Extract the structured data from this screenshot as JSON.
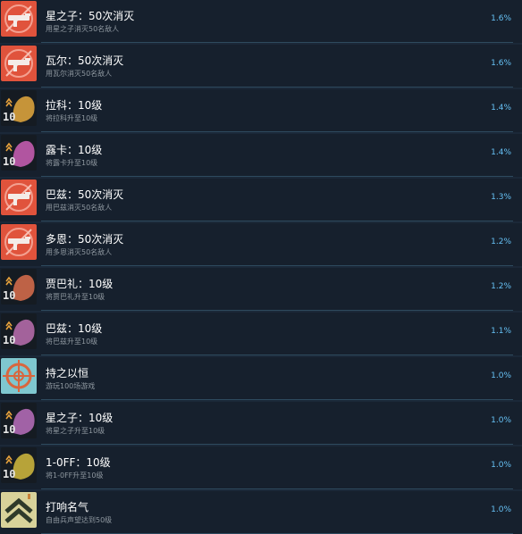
{
  "achievements": [
    {
      "title": "星之子：50次消灭",
      "desc": "用星之子消灭50名敌人",
      "percent": "1.6%",
      "icon": "weapon-kill-icon"
    },
    {
      "title": "瓦尔：50次消灭",
      "desc": "用瓦尔消灭50名敌人",
      "percent": "1.6%",
      "icon": "weapon-kill-icon"
    },
    {
      "title": "拉科：10级",
      "desc": "将拉科升至10级",
      "percent": "1.4%",
      "icon": "character-level-icon",
      "badge": "10"
    },
    {
      "title": "露卡：10级",
      "desc": "将露卡升至10级",
      "percent": "1.4%",
      "icon": "character-level-icon",
      "badge": "10"
    },
    {
      "title": "巴兹：50次消灭",
      "desc": "用巴兹消灭50名敌人",
      "percent": "1.3%",
      "icon": "weapon-kill-icon"
    },
    {
      "title": "多恩：50次消灭",
      "desc": "用多恩消灭50名敌人",
      "percent": "1.2%",
      "icon": "weapon-kill-icon"
    },
    {
      "title": "贾巴礼：10级",
      "desc": "将贾巴礼升至10级",
      "percent": "1.2%",
      "icon": "character-level-icon",
      "badge": "10"
    },
    {
      "title": "巴兹：10级",
      "desc": "将巴兹升至10级",
      "percent": "1.1%",
      "icon": "character-level-icon",
      "badge": "10"
    },
    {
      "title": "持之以恒",
      "desc": "游玩100场游戏",
      "percent": "1.0%",
      "icon": "crosshair-icon"
    },
    {
      "title": "星之子：10级",
      "desc": "将星之子升至10级",
      "percent": "1.0%",
      "icon": "character-level-icon",
      "badge": "10"
    },
    {
      "title": "1-0FF：10级",
      "desc": "将1-0FF升至10级",
      "percent": "1.0%",
      "icon": "character-level-icon",
      "badge": "10"
    },
    {
      "title": "打响名气",
      "desc": "自由兵声望达到50级",
      "percent": "1.0%",
      "icon": "rank-chevron-icon"
    }
  ],
  "colors": {
    "background": "#1b2838",
    "row": "#16202d",
    "divider": "#2e4a5e",
    "title": "#ffffff",
    "description": "#8f98a0",
    "percent": "#66c0f4",
    "kill_icon_bg": "#e0533c",
    "level_icon_bg": "#151b22",
    "crosshair_icon_bg": "#7fc7cf",
    "rank_icon_bg": "#d8d29a"
  }
}
